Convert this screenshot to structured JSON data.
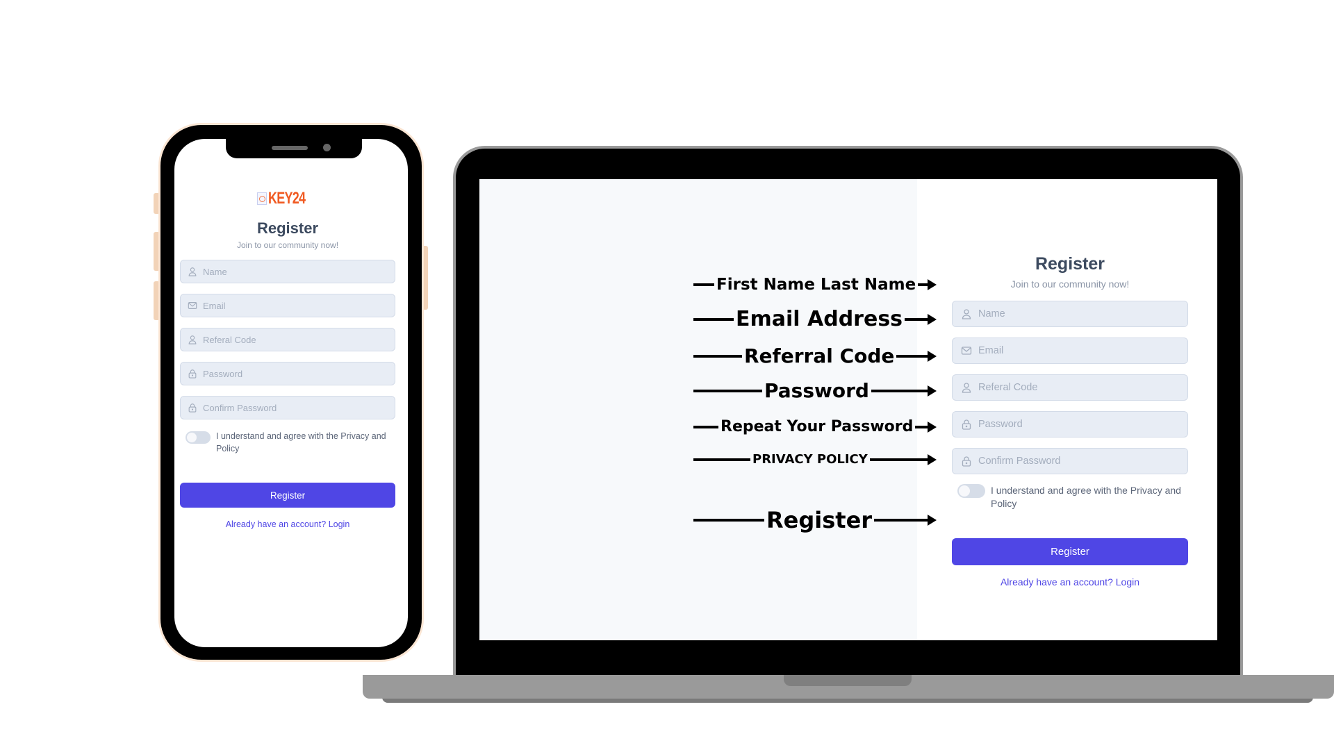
{
  "brand": {
    "logo_text": "KEY24",
    "accent_color": "#4f46e5",
    "logo_color": "#f05a22"
  },
  "form": {
    "title": "Register",
    "subtitle": "Join to our community now!",
    "fields": [
      {
        "icon": "user-icon",
        "placeholder": "Name",
        "value": ""
      },
      {
        "icon": "mail-icon",
        "placeholder": "Email",
        "value": ""
      },
      {
        "icon": "user-icon",
        "placeholder": "Referal Code",
        "value": ""
      },
      {
        "icon": "lock-icon",
        "placeholder": "Password",
        "value": ""
      },
      {
        "icon": "lock-icon",
        "placeholder": "Confirm Password",
        "value": ""
      }
    ],
    "agree_text": "I understand and agree with the Privacy and Policy",
    "agree_checked": false,
    "submit_label": "Register",
    "login_link": "Already have an account? Login"
  },
  "annotations": [
    {
      "label": "First Name Last Name",
      "target": "Name"
    },
    {
      "label": "Email Address",
      "target": "Email"
    },
    {
      "label": "Referral Code",
      "target": "Referal Code"
    },
    {
      "label": "Password",
      "target": "Password"
    },
    {
      "label": "Repeat Your Password",
      "target": "Confirm Password"
    },
    {
      "label": "PRIVACY POLICY",
      "target": "Privacy toggle"
    },
    {
      "label": "Register",
      "target": "Register button"
    }
  ]
}
